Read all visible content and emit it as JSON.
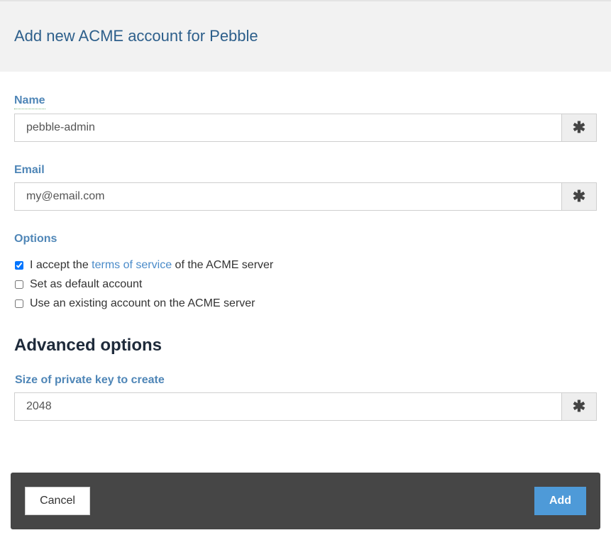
{
  "dialog": {
    "title": "Add new ACME account for Pebble"
  },
  "form": {
    "name": {
      "label": "Name",
      "value": "pebble-admin"
    },
    "email": {
      "label": "Email",
      "value": "my@email.com"
    },
    "required_symbol": "✱",
    "options": {
      "label": "Options",
      "accept_tos": {
        "prefix": "I accept the ",
        "link": "terms of service",
        "suffix": " of the ACME server",
        "checked": true
      },
      "set_default": {
        "label": "Set as default account",
        "checked": false
      },
      "use_existing": {
        "label": "Use an existing account on the ACME server",
        "checked": false
      }
    },
    "advanced": {
      "heading": "Advanced options",
      "key_size": {
        "label": "Size of private key to create",
        "value": "2048"
      }
    }
  },
  "footer": {
    "cancel_label": "Cancel",
    "add_label": "Add"
  },
  "colors": {
    "label": "#4f86b7",
    "title": "#2d5f8b",
    "link": "#4a8bc9",
    "primary_button": "#4e9ad8",
    "footer_bg": "#464646"
  }
}
